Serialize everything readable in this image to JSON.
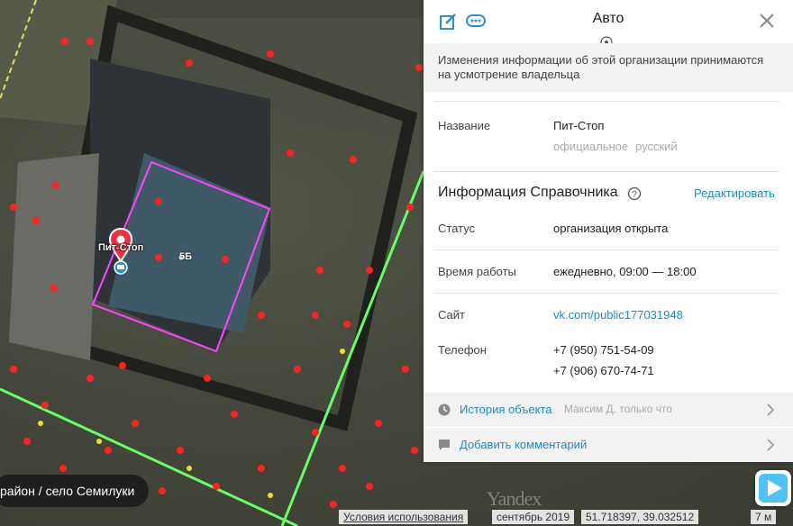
{
  "map": {
    "pin_label": "Пит-Стоп",
    "house_number": "5Б",
    "region": "район / село Семилуки",
    "logo": "Yandex",
    "terms": "Условия использования",
    "imagery_date": "сентябрь 2019",
    "coords": "51.718397, 39.032512",
    "scale": "7 м",
    "colors": {
      "outline": "#ff44ff",
      "road_line": "#66ff66",
      "dots": "#ff2020"
    }
  },
  "panel": {
    "title": "Авто",
    "notice": "Изменения информации об этой организации принимаются на усмотрение владельца",
    "name_label": "Название",
    "name_value": "Пит-Стоп",
    "name_tag_official": "официальное",
    "name_tag_lang": "русский",
    "section_title": "Информация Справочника",
    "edit_link": "Редактировать",
    "status_label": "Статус",
    "status_value": "организация открыта",
    "hours_label": "Время работы",
    "hours_value": "ежедневно, 09:00 — 18:00",
    "site_label": "Сайт",
    "site_value": "vk.com/public177031948",
    "phone_label": "Телефон",
    "phone_1": "+7 (950) 751-54-09",
    "phone_2": "+7 (906) 670-74-71",
    "history_label": "История объекта",
    "history_meta": "Максим Д. только что",
    "comment_label": "Добавить комментарий",
    "icons": [
      "edit-icon",
      "more-icon",
      "close-icon",
      "target-icon",
      "help-icon",
      "clock-icon",
      "comment-icon",
      "chevron-right-icon",
      "navigation-icon",
      "map-pin-icon"
    ]
  }
}
